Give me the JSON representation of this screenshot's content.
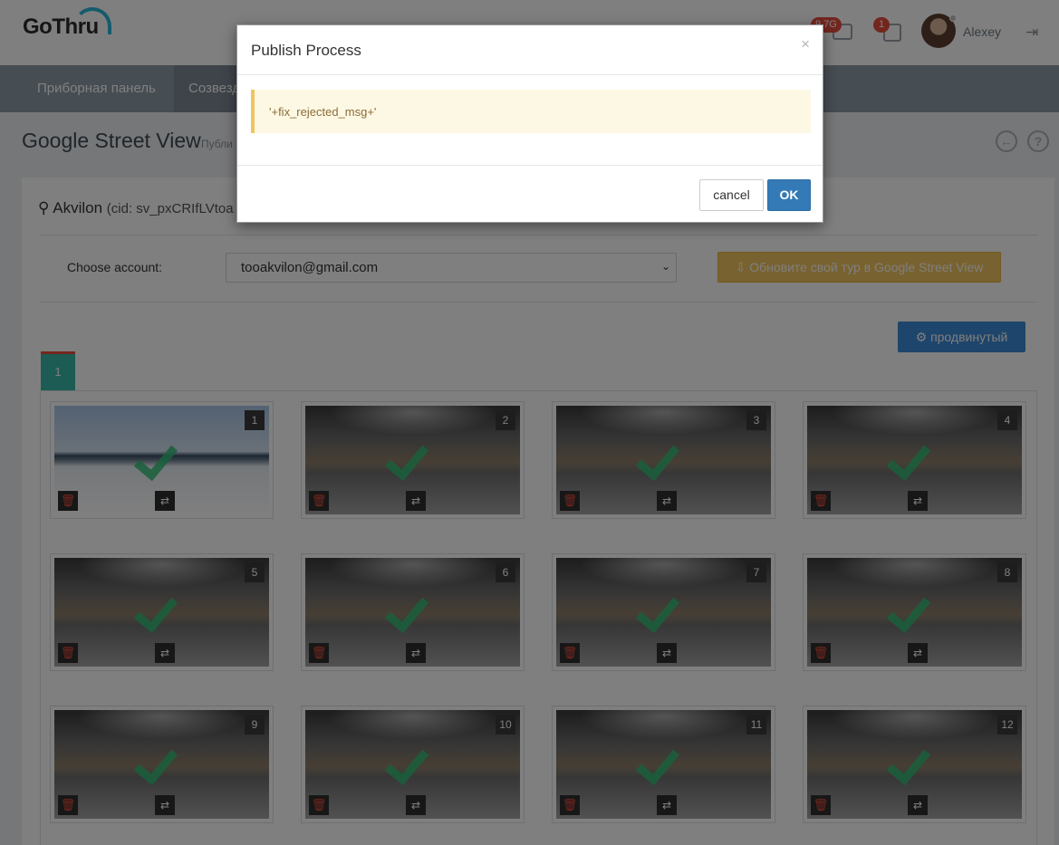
{
  "header": {
    "logo_text": "GoThru",
    "storage_badge": "9.7G",
    "notifications_badge": "1",
    "user_name": "Alexey"
  },
  "nav": {
    "items": [
      {
        "label": "Приборная панель"
      },
      {
        "label": "Созвезд"
      }
    ]
  },
  "page": {
    "title": "Google Street View",
    "subtitle": "Публи"
  },
  "tour": {
    "location_name": "Akvilon",
    "cid": "(cid: sv_pxCRIfLVtoa"
  },
  "account": {
    "label": "Choose account:",
    "selected": "tooakvilon@gmail.com",
    "update_button": "Обновите свой тур в Google Street View"
  },
  "advanced_button": "продвинутый",
  "tab": {
    "label": "1"
  },
  "panoramas": [
    {
      "number": "1",
      "kind": "snow"
    },
    {
      "number": "2",
      "kind": "indoor"
    },
    {
      "number": "3",
      "kind": "indoor"
    },
    {
      "number": "4",
      "kind": "indoor"
    },
    {
      "number": "5",
      "kind": "indoor"
    },
    {
      "number": "6",
      "kind": "indoor"
    },
    {
      "number": "7",
      "kind": "indoor"
    },
    {
      "number": "8",
      "kind": "indoor"
    },
    {
      "number": "9",
      "kind": "indoor"
    },
    {
      "number": "10",
      "kind": "indoor"
    },
    {
      "number": "11",
      "kind": "indoor"
    },
    {
      "number": "12",
      "kind": "indoor"
    }
  ],
  "modal": {
    "title": "Publish Process",
    "close_symbol": "×",
    "message": "'+fix_rejected_msg+'",
    "cancel_label": "cancel",
    "ok_label": "OK"
  },
  "colors": {
    "accent_gold": "#f0c45e",
    "accent_blue": "#3d8ad6",
    "tab_teal": "#38b8a8",
    "ok_blue": "#337ab7"
  }
}
